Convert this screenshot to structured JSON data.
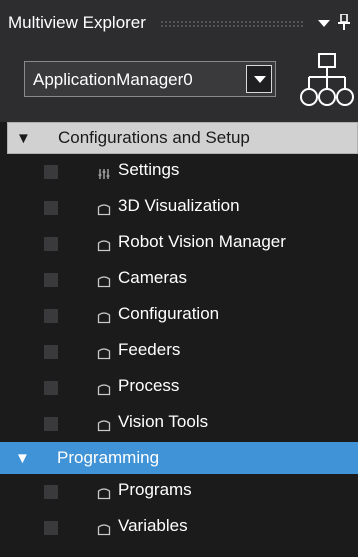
{
  "panel": {
    "title": "Multiview Explorer",
    "dropdown_icon": "chevron-down-icon",
    "pin_icon": "pin-icon"
  },
  "toolbar": {
    "selected_project": "ApplicationManager0",
    "hierarchy_icon": "hierarchy-icon"
  },
  "tree": {
    "groups": [
      {
        "label": "Configurations and Setup",
        "expanded": true,
        "state": "selected",
        "items": [
          {
            "label": "Settings",
            "icon": "settings-icon"
          },
          {
            "label": "3D Visualization",
            "icon": "folder-icon"
          },
          {
            "label": "Robot Vision Manager",
            "icon": "folder-icon"
          },
          {
            "label": "Cameras",
            "icon": "folder-icon"
          },
          {
            "label": "Configuration",
            "icon": "folder-icon"
          },
          {
            "label": "Feeders",
            "icon": "folder-icon"
          },
          {
            "label": "Process",
            "icon": "folder-icon"
          },
          {
            "label": "Vision Tools",
            "icon": "folder-icon"
          }
        ]
      },
      {
        "label": "Programming",
        "expanded": true,
        "state": "hover",
        "items": [
          {
            "label": "Programs",
            "icon": "folder-icon"
          },
          {
            "label": "Variables",
            "icon": "folder-icon"
          }
        ]
      }
    ]
  },
  "colors": {
    "background": "#1b1b1c",
    "header_bar": "#2d2d30",
    "selected_group": "#d1d1d1",
    "hover_group": "#3f93d6",
    "text": "#ffffff"
  }
}
